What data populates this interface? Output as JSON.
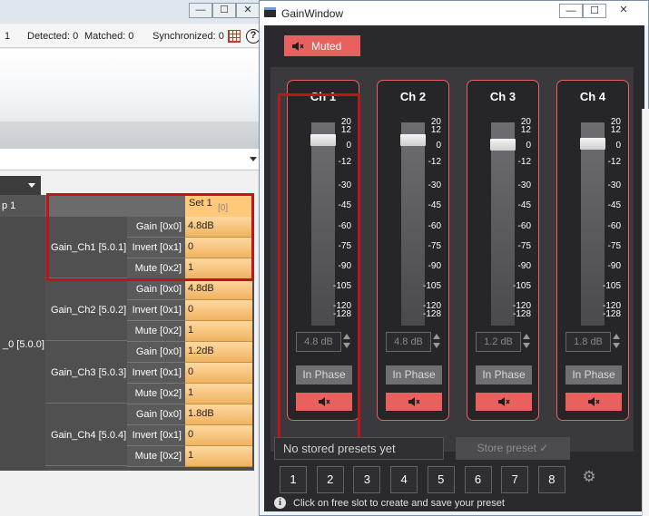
{
  "background_window": {
    "controls": [
      "—",
      "☐",
      "✕"
    ],
    "status": {
      "count": "1",
      "detected": "Detected: 0",
      "matched": "Matched: 0",
      "synchronized": "Synchronized: 0",
      "help": "?"
    },
    "grid": {
      "header_left": "p 1",
      "set_label": "Set 1",
      "set_sub": "[0]",
      "group_label": "_0 [5.0.0]",
      "channels": [
        {
          "name": "Gain_Ch1 [5.0.1]",
          "params": [
            {
              "label": "Gain [0x0]",
              "value": "4.8dB"
            },
            {
              "label": "Invert [0x1]",
              "value": "0"
            },
            {
              "label": "Mute [0x2]",
              "value": "1"
            }
          ]
        },
        {
          "name": "Gain_Ch2 [5.0.2]",
          "params": [
            {
              "label": "Gain [0x0]",
              "value": "4.8dB"
            },
            {
              "label": "Invert [0x1]",
              "value": "0"
            },
            {
              "label": "Mute [0x2]",
              "value": "1"
            }
          ]
        },
        {
          "name": "Gain_Ch3 [5.0.3]",
          "params": [
            {
              "label": "Gain [0x0]",
              "value": "1.2dB"
            },
            {
              "label": "Invert [0x1]",
              "value": "0"
            },
            {
              "label": "Mute [0x2]",
              "value": "1"
            }
          ]
        },
        {
          "name": "Gain_Ch4 [5.0.4]",
          "params": [
            {
              "label": "Gain [0x0]",
              "value": "1.8dB"
            },
            {
              "label": "Invert [0x1]",
              "value": "0"
            },
            {
              "label": "Mute [0x2]",
              "value": "1"
            }
          ]
        }
      ]
    }
  },
  "gain_window": {
    "title": "GainWindow",
    "controls": [
      "—",
      "☐",
      "✕"
    ],
    "muted_label": "Muted",
    "scale": [
      "20",
      "12",
      "0",
      "-12",
      "-30",
      "-45",
      "-60",
      "-75",
      "-90",
      "-105",
      "-120",
      "-128"
    ],
    "channels": [
      {
        "name": "Ch 1",
        "db": "4.8 dB",
        "phase": "In Phase",
        "level_db": 4.8
      },
      {
        "name": "Ch 2",
        "db": "4.8 dB",
        "phase": "In Phase",
        "level_db": 4.8
      },
      {
        "name": "Ch 3",
        "db": "1.2 dB",
        "phase": "In Phase",
        "level_db": 1.2
      },
      {
        "name": "Ch 4",
        "db": "1.8 dB",
        "phase": "In Phase",
        "level_db": 1.8
      }
    ],
    "presets": {
      "placeholder": "No stored presets yet",
      "store_label": "Store preset ✓",
      "slots": [
        "1",
        "2",
        "3",
        "4",
        "5",
        "6",
        "7",
        "8"
      ],
      "info": "Click on free slot to create and save your preset"
    },
    "colors": {
      "accent_red": "#e8615f",
      "highlight": "#c0141c",
      "panel_bg": "#262629"
    }
  }
}
